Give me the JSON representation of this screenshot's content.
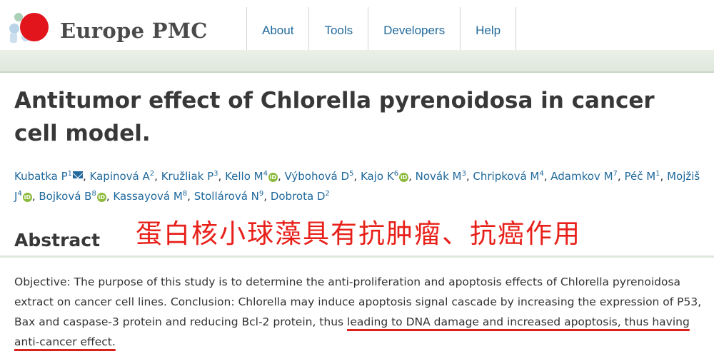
{
  "site": {
    "name": "Europe PMC",
    "nav": [
      {
        "label": "About"
      },
      {
        "label": "Tools"
      },
      {
        "label": "Developers"
      },
      {
        "label": "Help"
      }
    ]
  },
  "article": {
    "title": "Antitumor effect of Chlorella pyrenoidosa in cancer cell model.",
    "authors": [
      {
        "name": "Kubatka P",
        "sup": "1",
        "icon": "mail-icon"
      },
      {
        "name": "Kapinová A",
        "sup": "2"
      },
      {
        "name": "Kružliak P",
        "sup": "3"
      },
      {
        "name": "Kello M",
        "sup": "4",
        "icon": "orcid-icon"
      },
      {
        "name": "Výbohová D",
        "sup": "5"
      },
      {
        "name": "Kajo K",
        "sup": "6",
        "icon": "orcid-icon"
      },
      {
        "name": "Novák M",
        "sup": "3"
      },
      {
        "name": "Chripková M",
        "sup": "4"
      },
      {
        "name": "Adamkov M",
        "sup": "7"
      },
      {
        "name": "Péč M",
        "sup": "1"
      },
      {
        "name": "Mojžiš J",
        "sup": "4",
        "icon": "orcid-icon"
      },
      {
        "name": "Bojková B",
        "sup": "8",
        "icon": "orcid-icon"
      },
      {
        "name": "Kassayová M",
        "sup": "8"
      },
      {
        "name": "Stollárová N",
        "sup": "9"
      },
      {
        "name": "Dobrota D",
        "sup": "2"
      }
    ],
    "abstract_heading": "Abstract",
    "abstract_parts": [
      {
        "text": "Objective: The purpose of this study is to determine the anti-proliferation and apoptosis effects of Chlorella pyrenoidosa extract on cancer cell lines. Conclusion: Chlorella may induce apoptosis signal cascade by increasing the expression of P53, Bax and caspase-3 protein and reducing Bcl-2 protein, thus ",
        "underlined": false
      },
      {
        "text": "leading to DNA damage and increased apoptosis, thus having anti-cancer effect.",
        "underlined": true
      }
    ]
  },
  "annotation": {
    "text": "蛋白核小球藻具有抗肿瘤、抗癌作用",
    "color": "#e8201a"
  },
  "colors": {
    "link": "#20699c",
    "accent_red": "#e02020",
    "orcid_green": "#8cba3c"
  }
}
